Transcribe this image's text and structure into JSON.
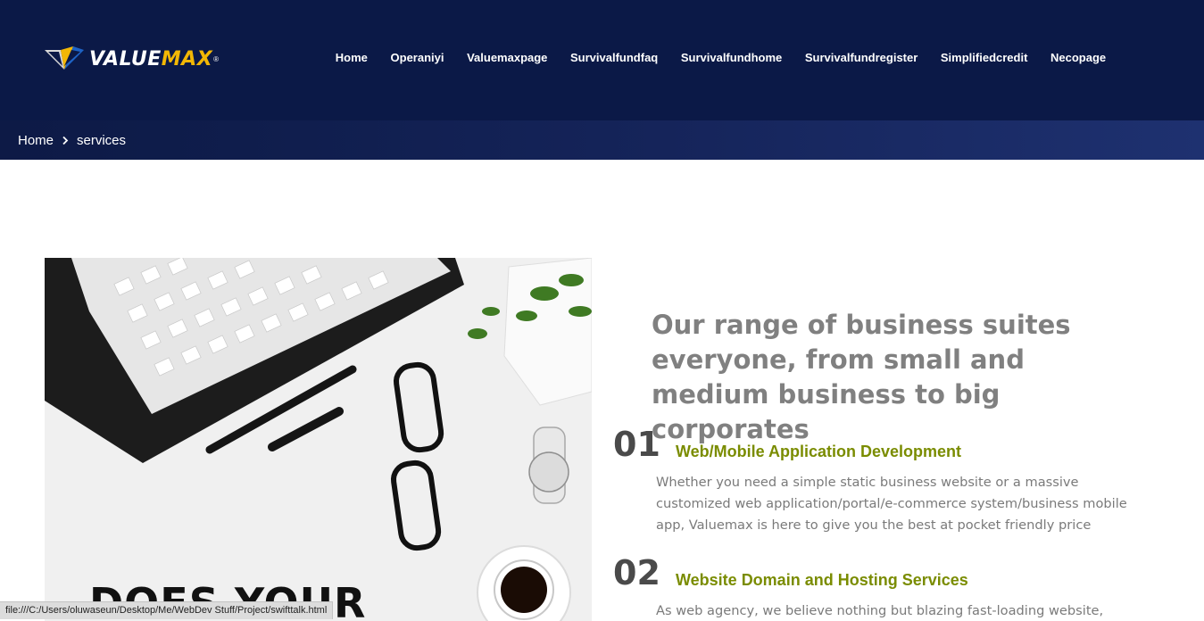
{
  "brand": {
    "name_main": "VALUE",
    "name_accent": "MAX",
    "registered": "®",
    "colors": {
      "header_bg": "#0b1947",
      "accent_yellow": "#f2b705",
      "service_title": "#7a8c00"
    }
  },
  "nav": {
    "items": [
      {
        "label": "Home"
      },
      {
        "label": "Operaniyi"
      },
      {
        "label": "Valuemaxpage"
      },
      {
        "label": "Survivalfundfaq"
      },
      {
        "label": "Survivalfundhome"
      },
      {
        "label": "Survivalfundregister"
      },
      {
        "label": "Simplifiedcredit"
      },
      {
        "label": "Necopage"
      }
    ]
  },
  "breadcrumb": {
    "home": "Home",
    "current": "services",
    "separator_icon": "chevron-right-icon"
  },
  "photo": {
    "caption": "DOES YOUR"
  },
  "content": {
    "headline": "Our range of business suites everyone, from small and medium business to big corporates",
    "services": [
      {
        "number": "01",
        "title": "Web/Mobile Application Development",
        "description": "Whether you need a simple static business website or a massive customized web application/portal/e-commerce system/business mobile app, Valuemax is here to give you the best at pocket friendly price"
      },
      {
        "number": "02",
        "title": "Website Domain and Hosting Services",
        "description": "As web agency, we believe nothing but blazing fast-loading website,"
      }
    ]
  },
  "status_bar": {
    "url": "file:///C:/Users/oluwaseun/Desktop/Me/WebDev Stuff/Project/swifttalk.html"
  }
}
